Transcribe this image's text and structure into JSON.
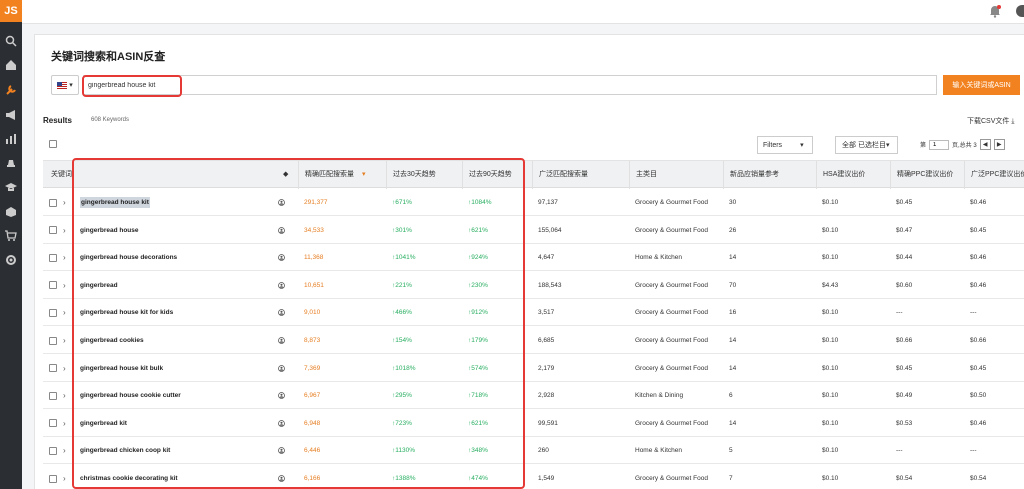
{
  "app": {
    "logo": "JS"
  },
  "sidebar": {
    "icons": [
      "search-icon",
      "home-icon",
      "wrench-icon",
      "megaphone-icon",
      "bar-chart-icon",
      "hat-icon",
      "graduation-icon",
      "box-icon",
      "cart-icon",
      "gear-icon"
    ]
  },
  "page": {
    "title": "关键词搜索和ASIN反查"
  },
  "search": {
    "country_flag": "US",
    "value": "gingerbread house kit",
    "button_label": "输入关键词或ASIN"
  },
  "results": {
    "label": "Results",
    "count": "608 Keywords",
    "download_label": "下载CSV文件"
  },
  "toolbar": {
    "filters_label": "Filters",
    "filters_arrow": "▾",
    "columns_label": "全部 已选栏目",
    "columns_arrow": "▾",
    "page_prefix": "第",
    "page_value": "1",
    "page_suffix": "页,总共 3",
    "prev": "◀",
    "next": "▶"
  },
  "table": {
    "headers": {
      "keyword": "关键词",
      "exact": "精确匹配搜索量",
      "trend30": "过去30天趋势",
      "trend90": "过去90天趋势",
      "broad": "广泛匹配搜索量",
      "category": "主类目",
      "new_sales": "新品应销量参考",
      "hsa": "HSA建议出价",
      "exact_ppc": "精确PPC建议出价",
      "broad_ppc": "广泛PPC建议出价"
    },
    "rows": [
      {
        "keyword": "gingerbread house kit",
        "exact": "291,377",
        "trend30": "↑671%",
        "trend90": "↑1084%",
        "broad": "97,137",
        "category": "Grocery & Gourmet Food",
        "new_sales": "30",
        "hsa": "$0.10",
        "exact_ppc": "$0.45",
        "broad_ppc": "$0.46"
      },
      {
        "keyword": "gingerbread house",
        "exact": "34,533",
        "trend30": "↑301%",
        "trend90": "↑621%",
        "broad": "155,064",
        "category": "Grocery & Gourmet Food",
        "new_sales": "26",
        "hsa": "$0.10",
        "exact_ppc": "$0.47",
        "broad_ppc": "$0.45"
      },
      {
        "keyword": "gingerbread house decorations",
        "exact": "11,368",
        "trend30": "↑1041%",
        "trend90": "↑924%",
        "broad": "4,647",
        "category": "Home & Kitchen",
        "new_sales": "14",
        "hsa": "$0.10",
        "exact_ppc": "$0.44",
        "broad_ppc": "$0.46"
      },
      {
        "keyword": "gingerbread",
        "exact": "10,651",
        "trend30": "↑221%",
        "trend90": "↑230%",
        "broad": "188,543",
        "category": "Grocery & Gourmet Food",
        "new_sales": "70",
        "hsa": "$4.43",
        "exact_ppc": "$0.60",
        "broad_ppc": "$0.46"
      },
      {
        "keyword": "gingerbread house kit for kids",
        "exact": "9,010",
        "trend30": "↑466%",
        "trend90": "↑912%",
        "broad": "3,517",
        "category": "Grocery & Gourmet Food",
        "new_sales": "16",
        "hsa": "$0.10",
        "exact_ppc": "---",
        "broad_ppc": "---"
      },
      {
        "keyword": "gingerbread cookies",
        "exact": "8,873",
        "trend30": "↑154%",
        "trend90": "↑179%",
        "broad": "6,685",
        "category": "Grocery & Gourmet Food",
        "new_sales": "14",
        "hsa": "$0.10",
        "exact_ppc": "$0.66",
        "broad_ppc": "$0.66"
      },
      {
        "keyword": "gingerbread house kit bulk",
        "exact": "7,369",
        "trend30": "↑1018%",
        "trend90": "↑574%",
        "broad": "2,179",
        "category": "Grocery & Gourmet Food",
        "new_sales": "14",
        "hsa": "$0.10",
        "exact_ppc": "$0.45",
        "broad_ppc": "$0.45"
      },
      {
        "keyword": "gingerbread house cookie cutter",
        "exact": "6,967",
        "trend30": "↑295%",
        "trend90": "↑718%",
        "broad": "2,928",
        "category": "Kitchen & Dining",
        "new_sales": "6",
        "hsa": "$0.10",
        "exact_ppc": "$0.49",
        "broad_ppc": "$0.50"
      },
      {
        "keyword": "gingerbread kit",
        "exact": "6,948",
        "trend30": "↑723%",
        "trend90": "↑621%",
        "broad": "99,591",
        "category": "Grocery & Gourmet Food",
        "new_sales": "14",
        "hsa": "$0.10",
        "exact_ppc": "$0.53",
        "broad_ppc": "$0.46"
      },
      {
        "keyword": "gingerbread chicken coop kit",
        "exact": "6,446",
        "trend30": "↑1130%",
        "trend90": "↑348%",
        "broad": "260",
        "category": "Home & Kitchen",
        "new_sales": "5",
        "hsa": "$0.10",
        "exact_ppc": "---",
        "broad_ppc": "---"
      },
      {
        "keyword": "christmas cookie decorating kit",
        "exact": "6,166",
        "trend30": "↑1388%",
        "trend90": "↑474%",
        "broad": "1,549",
        "category": "Grocery & Gourmet Food",
        "new_sales": "7",
        "hsa": "$0.10",
        "exact_ppc": "$0.54",
        "broad_ppc": "$0.54"
      }
    ]
  },
  "colors": {
    "accent": "#f2821f",
    "sidebar": "#2b2e33",
    "highlight": "#e53935",
    "trend_up": "#27ae60",
    "exact_volume": "#e67e22"
  }
}
